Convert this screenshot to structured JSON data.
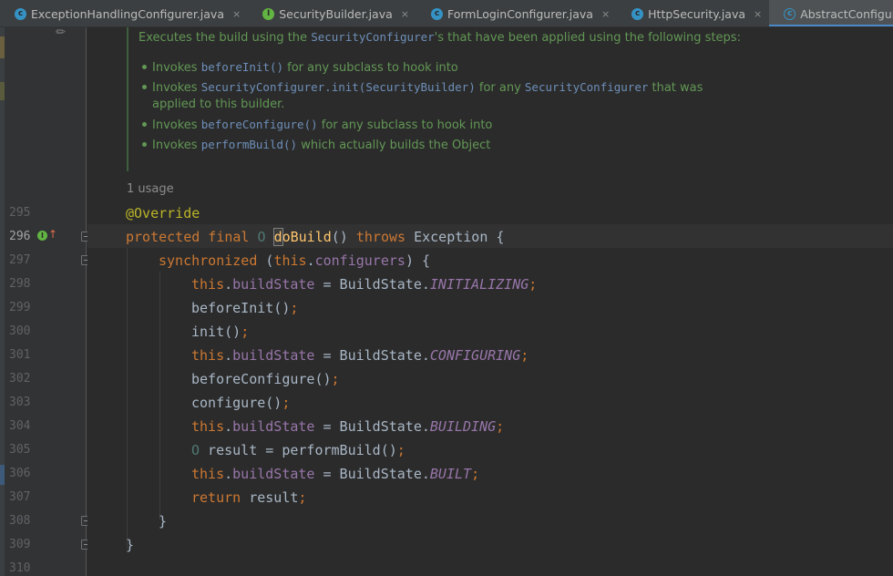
{
  "tabs": [
    {
      "label": "ExceptionHandlingConfigurer.java",
      "icon": "class-icon",
      "glyph": "c",
      "active": false
    },
    {
      "label": "SecurityBuilder.java",
      "icon": "interface-icon",
      "glyph": "I",
      "active": false
    },
    {
      "label": "FormLoginConfigurer.java",
      "icon": "class-icon",
      "glyph": "c",
      "active": false
    },
    {
      "label": "HttpSecurity.java",
      "icon": "class-icon",
      "glyph": "c",
      "active": false
    },
    {
      "label": "AbstractConfiguredSecurityBuilder.java",
      "icon": "abstract-class-icon",
      "glyph": "c",
      "active": true
    }
  ],
  "close_glyph": "×",
  "doc": {
    "intro_text": "Executes the build using the ",
    "intro_link": "SecurityConfigurer",
    "intro_rest": "'s that have been applied using the following steps:",
    "items": [
      {
        "pre": "Invokes ",
        "code": "beforeInit()",
        "post": " for any subclass to hook into"
      },
      {
        "pre": "Invokes ",
        "code": "SecurityConfigurer.init(SecurityBuilder)",
        "post": " for any ",
        "code2": "SecurityConfigurer",
        "post2": " that was"
      },
      {
        "cont": "applied to this builder."
      },
      {
        "pre": "Invokes ",
        "code": "beforeConfigure()",
        "post": " for any subclass to hook into"
      },
      {
        "pre": "Invokes ",
        "code": "performBuild()",
        "post": " which actually builds the Object"
      }
    ]
  },
  "usage_hint": "1 usage",
  "line_numbers": [
    "295",
    "296",
    "297",
    "298",
    "299",
    "300",
    "301",
    "302",
    "303",
    "304",
    "305",
    "306",
    "307",
    "308",
    "309",
    "310"
  ],
  "current_line": "296",
  "code": {
    "l295": {
      "annotation": "@Override"
    },
    "l296": {
      "kw1": "protected final ",
      "generic": "O ",
      "caret_char": "d",
      "method": "oBuild",
      "rest": "() ",
      "kw2": "throws",
      "tail": " Exception {"
    },
    "l297": {
      "kw": "synchronized",
      "p1": " (",
      "kw2": "this",
      "p2": ".",
      "field": "configurers",
      "p3": ") {"
    },
    "l298": {
      "kw": "this",
      "dot": ".",
      "field": "buildState",
      "eq": " = BuildState.",
      "const": "INITIALIZING",
      "semi": ";"
    },
    "l299": {
      "text": "beforeInit()",
      "semi": ";"
    },
    "l300": {
      "text": "init()",
      "semi": ";"
    },
    "l301": {
      "kw": "this",
      "dot": ".",
      "field": "buildState",
      "eq": " = BuildState.",
      "const": "CONFIGURING",
      "semi": ";"
    },
    "l302": {
      "text": "beforeConfigure()",
      "semi": ";"
    },
    "l303": {
      "text": "configure()",
      "semi": ";"
    },
    "l304": {
      "kw": "this",
      "dot": ".",
      "field": "buildState",
      "eq": " = BuildState.",
      "const": "BUILDING",
      "semi": ";"
    },
    "l305": {
      "generic": "O",
      "text": " result = performBuild()",
      "semi": ";"
    },
    "l306": {
      "kw": "this",
      "dot": ".",
      "field": "buildState",
      "eq": " = BuildState.",
      "const": "BUILT",
      "semi": ";"
    },
    "l307": {
      "kw": "return",
      "text": " result",
      "semi": ";"
    },
    "l308": {
      "text": "}"
    },
    "l309": {
      "text": "}"
    }
  },
  "colors": {
    "background": "#2b2b2b",
    "keyword": "#cc7832",
    "annotation": "#bbb529",
    "field": "#9876aa",
    "method_decl": "#ffc66d",
    "doc_comment": "#629755",
    "doc_code": "#6e8fb9",
    "active_tab_underline": "#4a88c7"
  }
}
